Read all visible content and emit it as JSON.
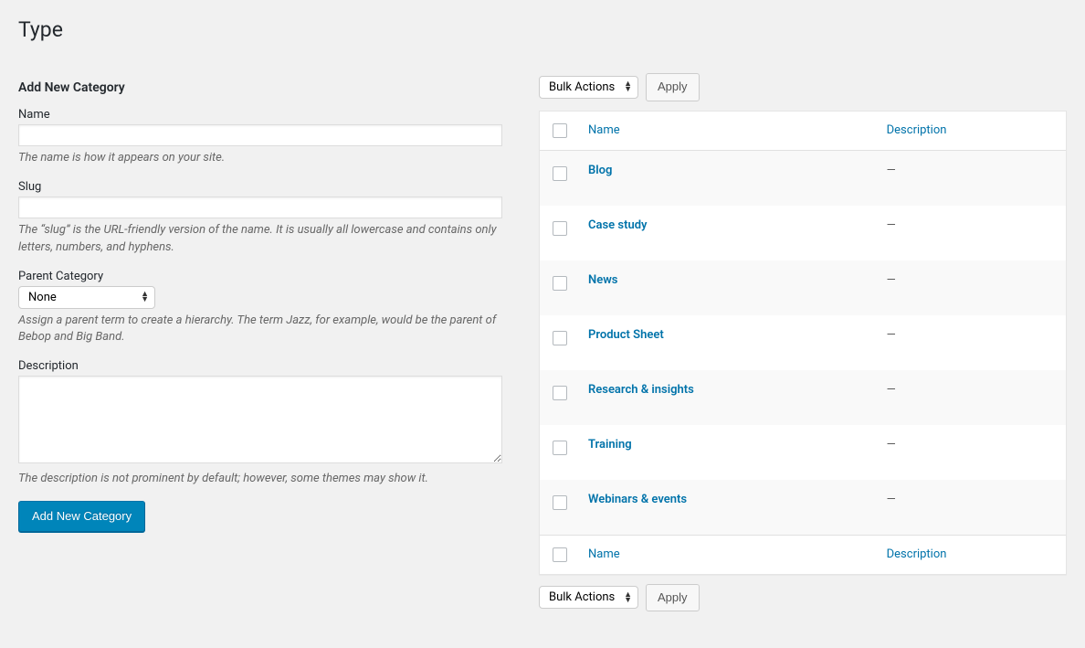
{
  "page": {
    "title": "Type"
  },
  "form": {
    "heading": "Add New Category",
    "name": {
      "label": "Name",
      "value": "",
      "help": "The name is how it appears on your site."
    },
    "slug": {
      "label": "Slug",
      "value": "",
      "help": "The “slug” is the URL-friendly version of the name. It is usually all lowercase and contains only letters, numbers, and hyphens."
    },
    "parent": {
      "label": "Parent Category",
      "selected": "None",
      "help": "Assign a parent term to create a hierarchy. The term Jazz, for example, would be the parent of Bebop and Big Band."
    },
    "description": {
      "label": "Description",
      "value": "",
      "help": "The description is not prominent by default; however, some themes may show it."
    },
    "submit_label": "Add New Category"
  },
  "bulk": {
    "selected": "Bulk Actions",
    "apply_label": "Apply"
  },
  "table": {
    "columns": {
      "name": "Name",
      "description": "Description"
    },
    "rows": [
      {
        "name": "Blog",
        "description": "—"
      },
      {
        "name": "Case study",
        "description": "—"
      },
      {
        "name": "News",
        "description": "—"
      },
      {
        "name": "Product Sheet",
        "description": "—"
      },
      {
        "name": "Research & insights",
        "description": "—"
      },
      {
        "name": "Training",
        "description": "—"
      },
      {
        "name": "Webinars & events",
        "description": "—"
      }
    ]
  }
}
